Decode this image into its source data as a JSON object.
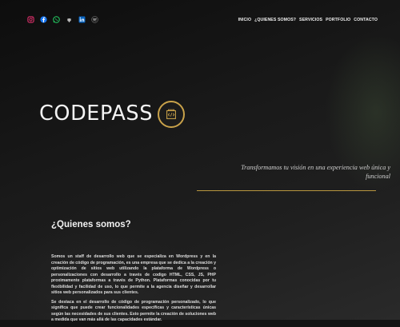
{
  "social": [
    {
      "icon": "instagram-icon"
    },
    {
      "icon": "facebook-icon"
    },
    {
      "icon": "whatsapp-icon"
    },
    {
      "icon": "github-icon"
    },
    {
      "icon": "linkedin-icon"
    },
    {
      "icon": "spotify-icon"
    }
  ],
  "nav": {
    "items": [
      "INICIO",
      "¿QUIENES SOMOS?",
      "SERVICIOS",
      "PORTFOLIO",
      "CONTACTO"
    ]
  },
  "hero": {
    "logo_text": "CODEPASS",
    "tagline": "Transformamos tu visión en una experiencia web única y funcional"
  },
  "about": {
    "title": "¿Quienes somos?",
    "paragraph_1": "Somos un staff de desarrollo web que se especializa en Wordpress y en la creación de código de programación, es una empresa que se dedica a la creación y optimización de sitios web utilizando la plataforma de Wordpress o personalizaciones con desarrollo a través de codigo HTML, CSS, JS, PHP proximamente plataformas a través de Python. Plataformas conocidas por tu flexibilidad y facilidad de uso, lo que permite a la agencia diseñar y desarrollar sitios web personalizados para sus clientes.",
    "paragraph_2": "Se destaca en el desarrollo de código de programación personalizado, lo que significa que puede crear funcionalidades específicas y características únicas según las necesidades de sus clientes. Esto permite la creación de soluciones web a medida que van más allá de las capacidades estándar."
  },
  "colors": {
    "accent_gold": "#c9a24a",
    "background": "#141414"
  }
}
